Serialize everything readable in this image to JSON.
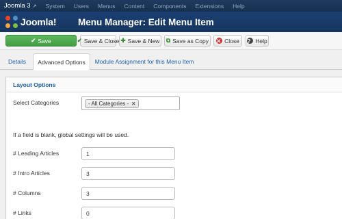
{
  "topnav": {
    "brand": "Joomla 3",
    "brand_icon": "external-link-icon",
    "items": [
      "System",
      "Users",
      "Menus",
      "Content",
      "Components",
      "Extensions",
      "Help"
    ]
  },
  "header": {
    "logo_text": "Joomla!",
    "title": "Menu Manager: Edit Menu Item"
  },
  "toolbar": {
    "save": {
      "label": "Save",
      "icon": "check-icon"
    },
    "save_close": {
      "label": "Save & Close",
      "icon": "check-icon"
    },
    "save_new": {
      "label": "Save & New",
      "icon": "plus-icon"
    },
    "save_copy": {
      "label": "Save as Copy",
      "icon": "copy-icon"
    },
    "close": {
      "label": "Close",
      "icon": "close-circle-icon"
    },
    "help": {
      "label": "Help",
      "icon": "question-circle-icon"
    }
  },
  "tabs": [
    "Details",
    "Advanced Options",
    "Module Assignment for this Menu Item"
  ],
  "active_tab": "Advanced Options",
  "panel": {
    "legend": "Layout Options",
    "select_categories_label": "Select Categories",
    "selected_category": "- All Categories -",
    "note": "If a field is blank, global settings will be used.",
    "fields": [
      {
        "label": "# Leading Articles",
        "value": "1"
      },
      {
        "label": "# Intro Articles",
        "value": "3"
      },
      {
        "label": "# Columns",
        "value": "3"
      },
      {
        "label": "# Links",
        "value": "0"
      }
    ]
  },
  "colors": {
    "nav_bg": "#1f3a5e",
    "header_bg": "#1a3f72",
    "save_green": "#4cae4c",
    "link_blue": "#1f5fa3"
  }
}
